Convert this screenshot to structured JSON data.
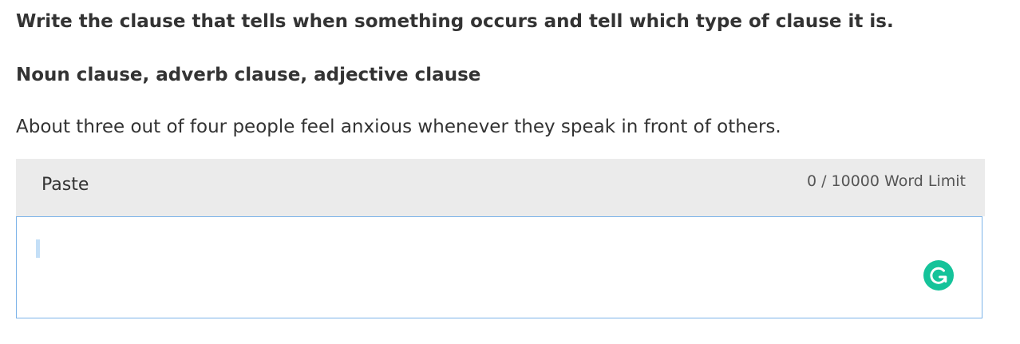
{
  "question": {
    "prompt": "Write the clause that tells when something occurs and tell which type of clause it is.",
    "options": "Noun clause, adverb clause, adjective clause",
    "sentence": "About three out of four people feel anxious whenever they speak in front of others."
  },
  "editor": {
    "paste_label": "Paste",
    "word_limit": "0 /  10000 Word Limit",
    "value": ""
  },
  "icons": {
    "grammarly": "grammarly-g-icon"
  },
  "colors": {
    "toolbar_bg": "#ebebeb",
    "input_border": "#7cb3e9",
    "grammarly_green": "#15c39a"
  }
}
